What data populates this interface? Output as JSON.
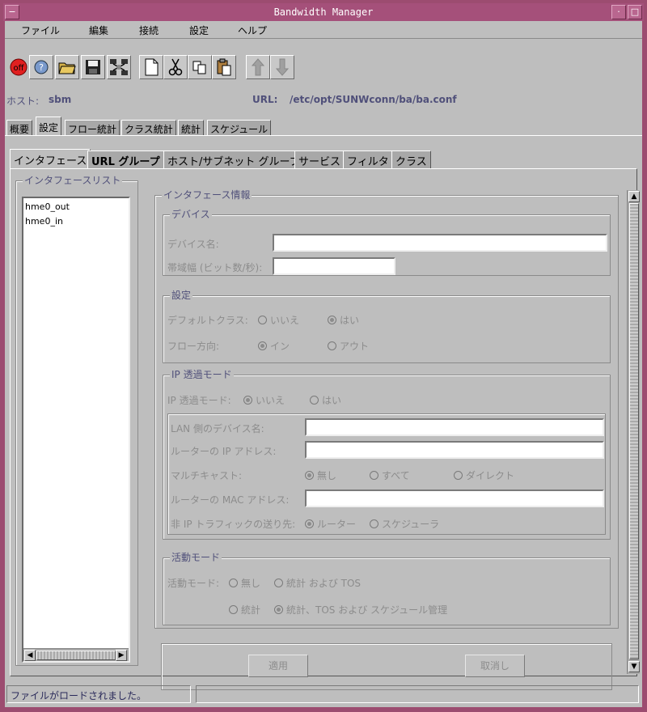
{
  "window": {
    "title": "Bandwidth Manager"
  },
  "menu": [
    "ファイル",
    "編集",
    "接続",
    "設定",
    "ヘルプ"
  ],
  "toolbar": {
    "off_label": "off"
  },
  "host": {
    "host_label": "ホスト:",
    "host_value": "sbm",
    "url_label": "URL:",
    "url_value": "/etc/opt/SUNWconn/ba/ba.conf"
  },
  "tabs_main": [
    "概要",
    "設定",
    "フロー統計",
    "クラス統計",
    "統計",
    "スケジュール"
  ],
  "tabs_sub": [
    "インタフェース",
    "URL グループ",
    "ホスト/サブネット グループ",
    "サービス",
    "フィルタ",
    "クラス"
  ],
  "iface_list": {
    "title": "インタフェースリスト",
    "items": [
      "hme0_out",
      "hme0_in"
    ]
  },
  "info": {
    "title": "インタフェース情報",
    "device": {
      "title": "デバイス",
      "name_label": "デバイス名:",
      "bw_label": "帯域幅 (ビット数/秒):"
    },
    "settings": {
      "title": "設定",
      "default_class_label": "デフォルトクラス:",
      "no": "いいえ",
      "yes": "はい",
      "flow_dir_label": "フロー方向:",
      "in": "イン",
      "out": "アウト"
    },
    "ip": {
      "title": "IP 透過モード",
      "mode_label": "IP 透過モード:",
      "no": "いいえ",
      "yes": "はい",
      "lan_dev_label": "LAN 側のデバイス名:",
      "router_ip_label": "ルーターの IP アドレス:",
      "multicast_label": "マルチキャスト:",
      "mc_none": "無し",
      "mc_all": "すべて",
      "mc_direct": "ダイレクト",
      "router_mac_label": "ルーターの MAC アドレス:",
      "non_ip_label": "非 IP トラフィックの送り先:",
      "router": "ルーター",
      "scheduler": "スケジューラ"
    },
    "activity": {
      "title": "活動モード",
      "mode_label": "活動モード:",
      "none": "無し",
      "stats_tos": "統計 および TOS",
      "stats": "統計",
      "stats_tos_sched": "統計、TOS および スケジュール管理"
    }
  },
  "buttons": {
    "apply": "適用",
    "cancel": "取消し"
  },
  "status": {
    "message": "ファイルがロードされました。"
  }
}
